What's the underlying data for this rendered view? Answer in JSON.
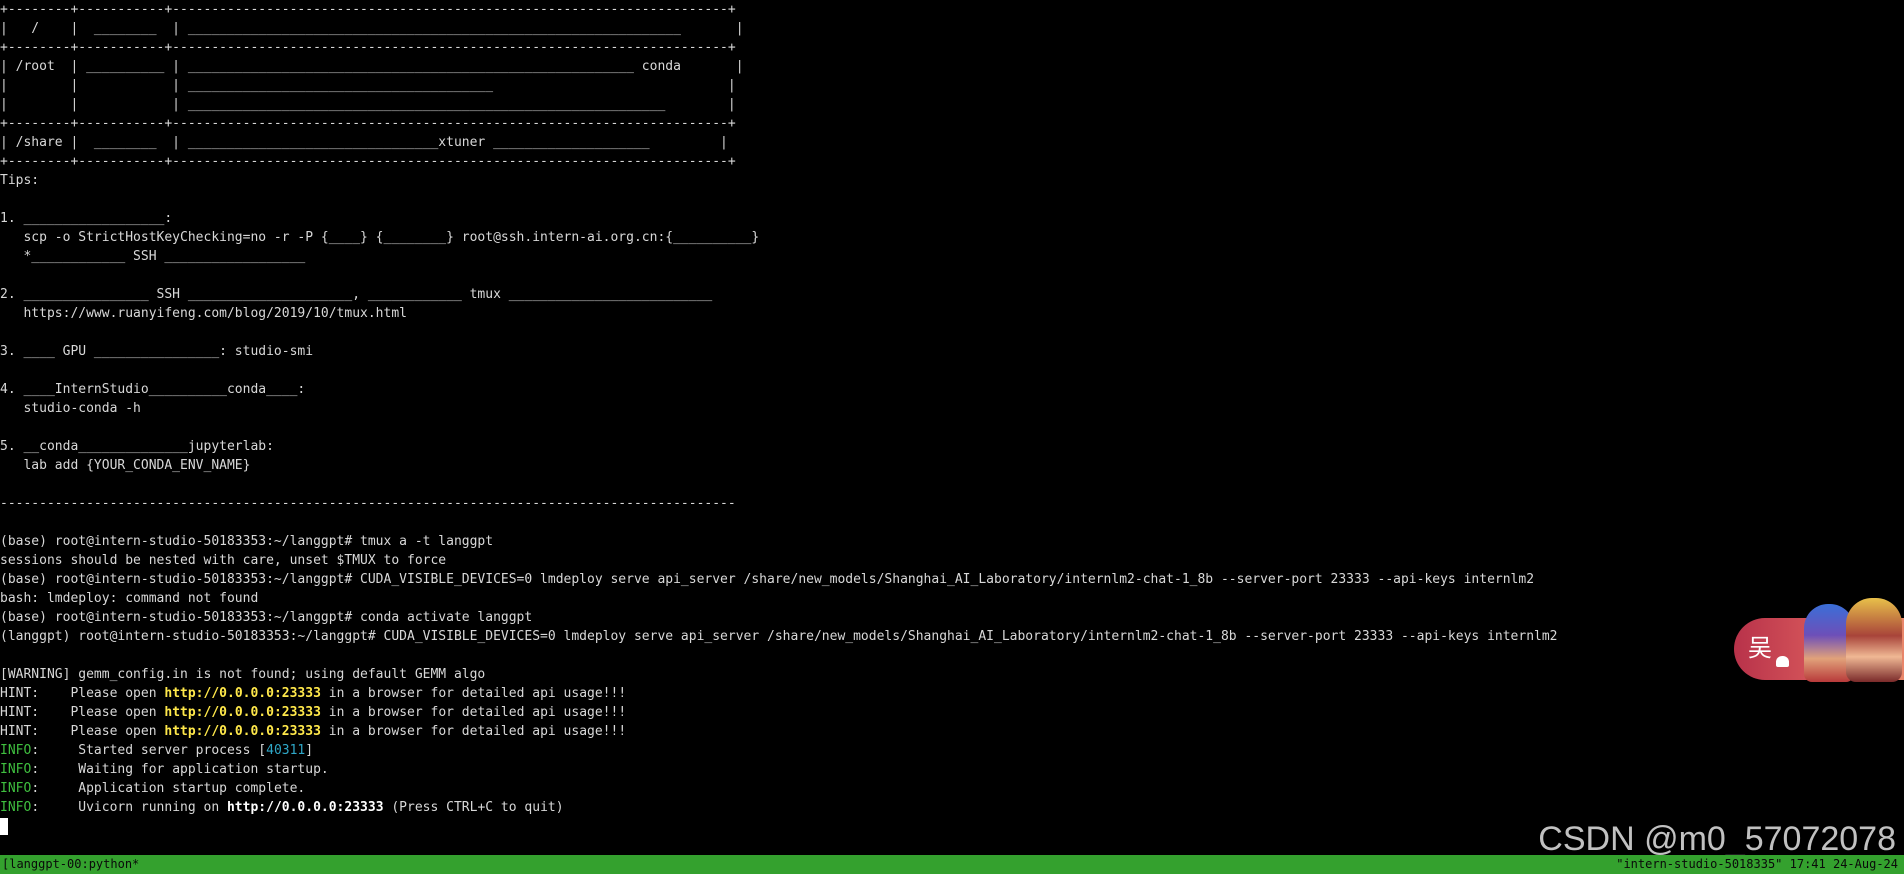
{
  "terminal": {
    "lines": [
      [
        {
          "t": "+--------+-----------+-----------------------------------------------------------------------+",
          "c": ""
        }
      ],
      [
        {
          "t": "|   /    |  ________  | _______________________________________________________________       |",
          "c": ""
        }
      ],
      [
        {
          "t": "+--------+-----------+-----------------------------------------------------------------------+",
          "c": ""
        }
      ],
      [
        {
          "t": "| /root  | __________ | _________________________________________________________ conda       |",
          "c": ""
        }
      ],
      [
        {
          "t": "|        |            | _______________________________________                              |",
          "c": ""
        }
      ],
      [
        {
          "t": "|        |            | _____________________________________________________________        |",
          "c": ""
        }
      ],
      [
        {
          "t": "+--------+-----------+-----------------------------------------------------------------------+",
          "c": ""
        }
      ],
      [
        {
          "t": "| /share |  ________  | ________________________________xtuner ____________________         |",
          "c": ""
        }
      ],
      [
        {
          "t": "+--------+-----------+-----------------------------------------------------------------------+",
          "c": ""
        }
      ],
      [
        {
          "t": "Tips:",
          "c": ""
        }
      ],
      [
        {
          "t": "",
          "c": ""
        }
      ],
      [
        {
          "t": "1. __________________:",
          "c": ""
        }
      ],
      [
        {
          "t": "   scp -o StrictHostKeyChecking=no -r -P {____} {________} root@ssh.intern-ai.org.cn:{__________}",
          "c": ""
        }
      ],
      [
        {
          "t": "   *____________ SSH __________________",
          "c": ""
        }
      ],
      [
        {
          "t": "",
          "c": ""
        }
      ],
      [
        {
          "t": "2. ________________ SSH _____________________, ____________ tmux __________________________",
          "c": ""
        }
      ],
      [
        {
          "t": "   https://www.ruanyifeng.com/blog/2019/10/tmux.html",
          "c": ""
        }
      ],
      [
        {
          "t": "",
          "c": ""
        }
      ],
      [
        {
          "t": "3. ____ GPU ________________: studio-smi",
          "c": ""
        }
      ],
      [
        {
          "t": "",
          "c": ""
        }
      ],
      [
        {
          "t": "4. ____InternStudio__________conda____:",
          "c": ""
        }
      ],
      [
        {
          "t": "   studio-conda -h",
          "c": ""
        }
      ],
      [
        {
          "t": "",
          "c": ""
        }
      ],
      [
        {
          "t": "5. __conda______________jupyterlab:",
          "c": ""
        }
      ],
      [
        {
          "t": "   lab add {YOUR_CONDA_ENV_NAME}",
          "c": ""
        }
      ],
      [
        {
          "t": "",
          "c": ""
        }
      ],
      [
        {
          "t": "----------------------------------------------------------------------------------------------",
          "c": ""
        }
      ],
      [
        {
          "t": "",
          "c": ""
        }
      ],
      [
        {
          "t": "(base) root@intern-studio-50183353:~/langgpt# tmux a -t langgpt",
          "c": ""
        }
      ],
      [
        {
          "t": "sessions should be nested with care, unset $TMUX to force",
          "c": ""
        }
      ],
      [
        {
          "t": "(base) root@intern-studio-50183353:~/langgpt# CUDA_VISIBLE_DEVICES=0 lmdeploy serve api_server /share/new_models/Shanghai_AI_Laboratory/internlm2-chat-1_8b --server-port 23333 --api-keys internlm2",
          "c": ""
        }
      ],
      [
        {
          "t": "bash: lmdeploy: command not found",
          "c": ""
        }
      ],
      [
        {
          "t": "(base) root@intern-studio-50183353:~/langgpt# conda activate langgpt",
          "c": ""
        }
      ],
      [
        {
          "t": "(langgpt) root@intern-studio-50183353:~/langgpt# CUDA_VISIBLE_DEVICES=0 lmdeploy serve api_server /share/new_models/Shanghai_AI_Laboratory/internlm2-chat-1_8b --server-port 23333 --api-keys internlm2",
          "c": ""
        }
      ],
      [
        {
          "t": "",
          "c": ""
        }
      ],
      [
        {
          "t": "[WARNING] gemm_config.in is not found; using default GEMM algo",
          "c": ""
        }
      ],
      [
        {
          "t": "HINT:    Please open ",
          "c": ""
        },
        {
          "t": "http://0.0.0.0:23333",
          "c": "yellow"
        },
        {
          "t": " in a browser for detailed api usage!!!",
          "c": ""
        }
      ],
      [
        {
          "t": "HINT:    Please open ",
          "c": ""
        },
        {
          "t": "http://0.0.0.0:23333",
          "c": "yellow"
        },
        {
          "t": " in a browser for detailed api usage!!!",
          "c": ""
        }
      ],
      [
        {
          "t": "HINT:    Please open ",
          "c": ""
        },
        {
          "t": "http://0.0.0.0:23333",
          "c": "yellow"
        },
        {
          "t": " in a browser for detailed api usage!!!",
          "c": ""
        }
      ],
      [
        {
          "t": "INFO",
          "c": "green"
        },
        {
          "t": ":     Started server process [",
          "c": ""
        },
        {
          "t": "40311",
          "c": "cyan"
        },
        {
          "t": "]",
          "c": ""
        }
      ],
      [
        {
          "t": "INFO",
          "c": "green"
        },
        {
          "t": ":     Waiting for application startup.",
          "c": ""
        }
      ],
      [
        {
          "t": "INFO",
          "c": "green"
        },
        {
          "t": ":     Application startup complete.",
          "c": ""
        }
      ],
      [
        {
          "t": "INFO",
          "c": "green"
        },
        {
          "t": ":     Uvicorn running on ",
          "c": ""
        },
        {
          "t": "http://0.0.0.0:23333",
          "c": "bold"
        },
        {
          "t": " (Press CTRL+C to quit)",
          "c": ""
        }
      ]
    ]
  },
  "status_bar": {
    "left": "[langgpt-00:python*",
    "right": "\"intern-studio-5018335\" 17:41 24-Aug-24"
  },
  "widget": {
    "char": "吴"
  },
  "watermark": {
    "text": "CSDN @m0_57072078"
  },
  "colors": {
    "background": "#000000",
    "text": "#d8d8d8",
    "url_highlight": "#ffe84a",
    "info_label": "#3fbf3f",
    "pid": "#2fa8c8",
    "status_bar": "#34a12e"
  }
}
